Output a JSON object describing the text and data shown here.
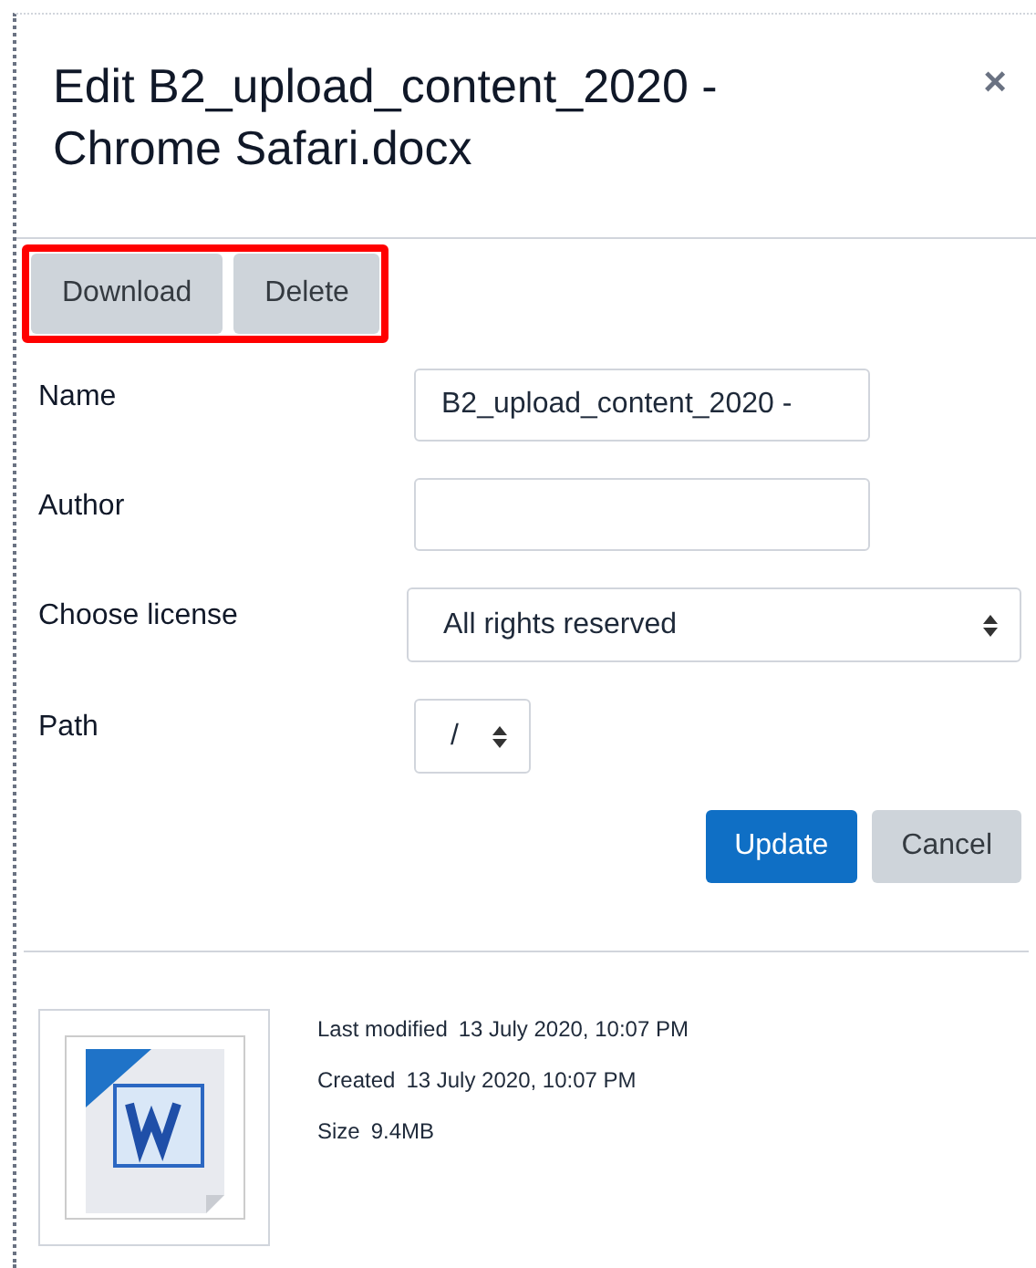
{
  "dialog": {
    "title": "Edit B2_upload_content_2020 - Chrome Safari.docx",
    "close": "×"
  },
  "file_actions": [
    {
      "label": "Download"
    },
    {
      "label": "Delete"
    }
  ],
  "fields": [
    {
      "kind": "text",
      "label": "Name",
      "value": "B2_upload_content_2020 -"
    },
    {
      "kind": "text",
      "label": "Author"
    },
    {
      "kind": "select",
      "label": "Choose license",
      "value": "All rights reserved",
      "wide": true
    },
    {
      "kind": "select",
      "label": "Path",
      "value": "/",
      "wide": false
    }
  ],
  "buttons": [
    {
      "label": "Update",
      "primary": true
    },
    {
      "label": "Cancel",
      "primary": false
    }
  ],
  "details": [
    {
      "label": "Last modified",
      "value": "13 July 2020, 10:07 PM"
    },
    {
      "label": "Created",
      "value": "13 July 2020, 10:07 PM"
    },
    {
      "label": "Size",
      "value": "9.4MB"
    }
  ]
}
